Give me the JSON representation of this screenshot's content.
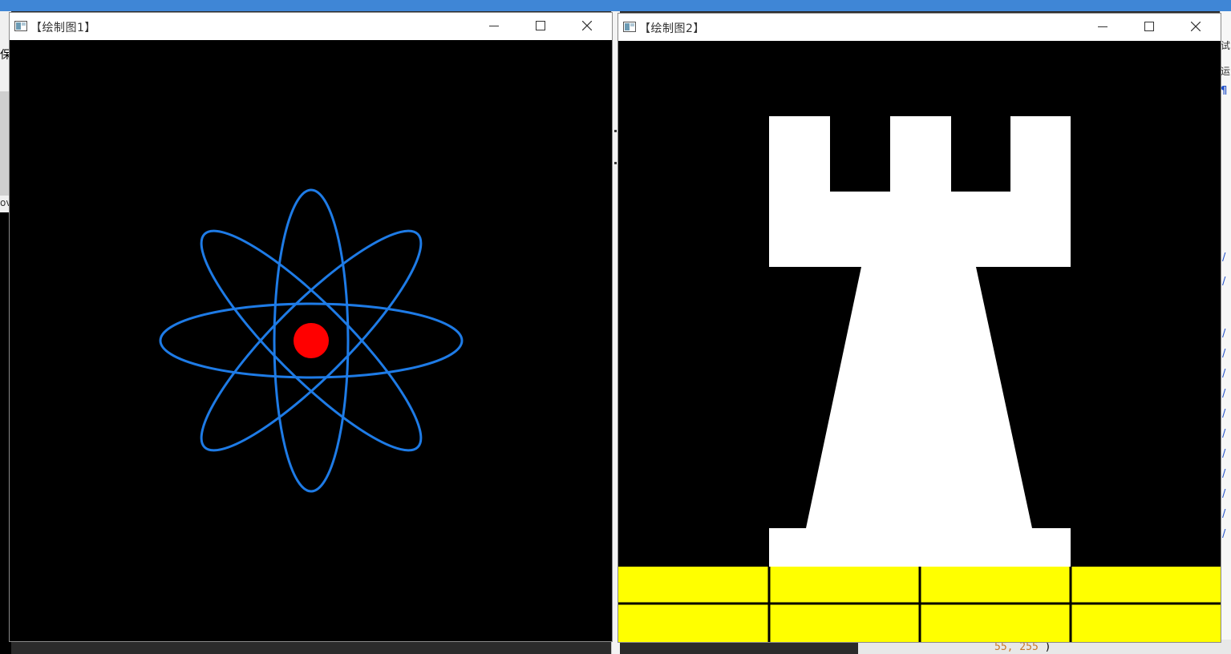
{
  "background": {
    "left_glyph": "保",
    "left_glyph2": "ov",
    "right_glyph1": "试",
    "right_glyph2": "运",
    "right_glyph3": "¶",
    "right_marks": [
      "/",
      "/",
      "/",
      "/",
      "/",
      "/",
      "/",
      "/",
      "/",
      "/",
      "/",
      "/",
      "/"
    ],
    "bottom_code_a": "55, 255 ",
    "bottom_code_b": ")"
  },
  "windows": [
    {
      "title": "【绘制图1】",
      "controls": {
        "minimize": "minimize-icon",
        "maximize": "maximize-icon",
        "close": "close-icon"
      },
      "drawing": {
        "kind": "atom",
        "orbit_color": "#1e7be6",
        "nucleus_color": "#ff0000",
        "background_color": "#000000",
        "orbit_angles_deg": [
          0,
          45,
          90,
          135
        ]
      }
    },
    {
      "title": "【绘制图2】",
      "controls": {
        "minimize": "minimize-icon",
        "maximize": "maximize-icon",
        "close": "close-icon"
      },
      "drawing": {
        "kind": "rook",
        "piece_color": "#ffffff",
        "floor_color": "#ffff00",
        "line_color": "#000000",
        "background_color": "#000000"
      }
    }
  ]
}
